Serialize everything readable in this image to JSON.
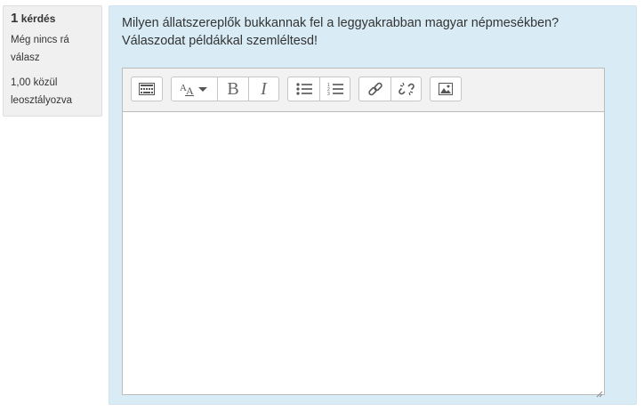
{
  "question_info": {
    "number": "1",
    "label": "kérdés",
    "state": "Még nincs rá válasz",
    "grade": "1,00 közül leosztályozva"
  },
  "question": {
    "text_line1": "Milyen állatszereplők bukkannak fel a leggyakrabban magyar népmesékben?",
    "text_line2": "Válaszodat példákkal szemléltesd!"
  },
  "editor": {
    "content": "",
    "toolbar": {
      "groups": [
        [
          "toolbar-toggle-icon"
        ],
        [
          "font-style-icon",
          "bold-icon",
          "italic-icon"
        ],
        [
          "unordered-list-icon",
          "ordered-list-icon"
        ],
        [
          "link-icon",
          "unlink-icon"
        ],
        [
          "image-icon"
        ]
      ],
      "bold_glyph": "B",
      "italic_glyph": "I"
    }
  },
  "colors": {
    "content_bg": "#d9ecf6",
    "info_bg": "#f0f0f0",
    "toolbar_bg": "#f2f2f2"
  }
}
